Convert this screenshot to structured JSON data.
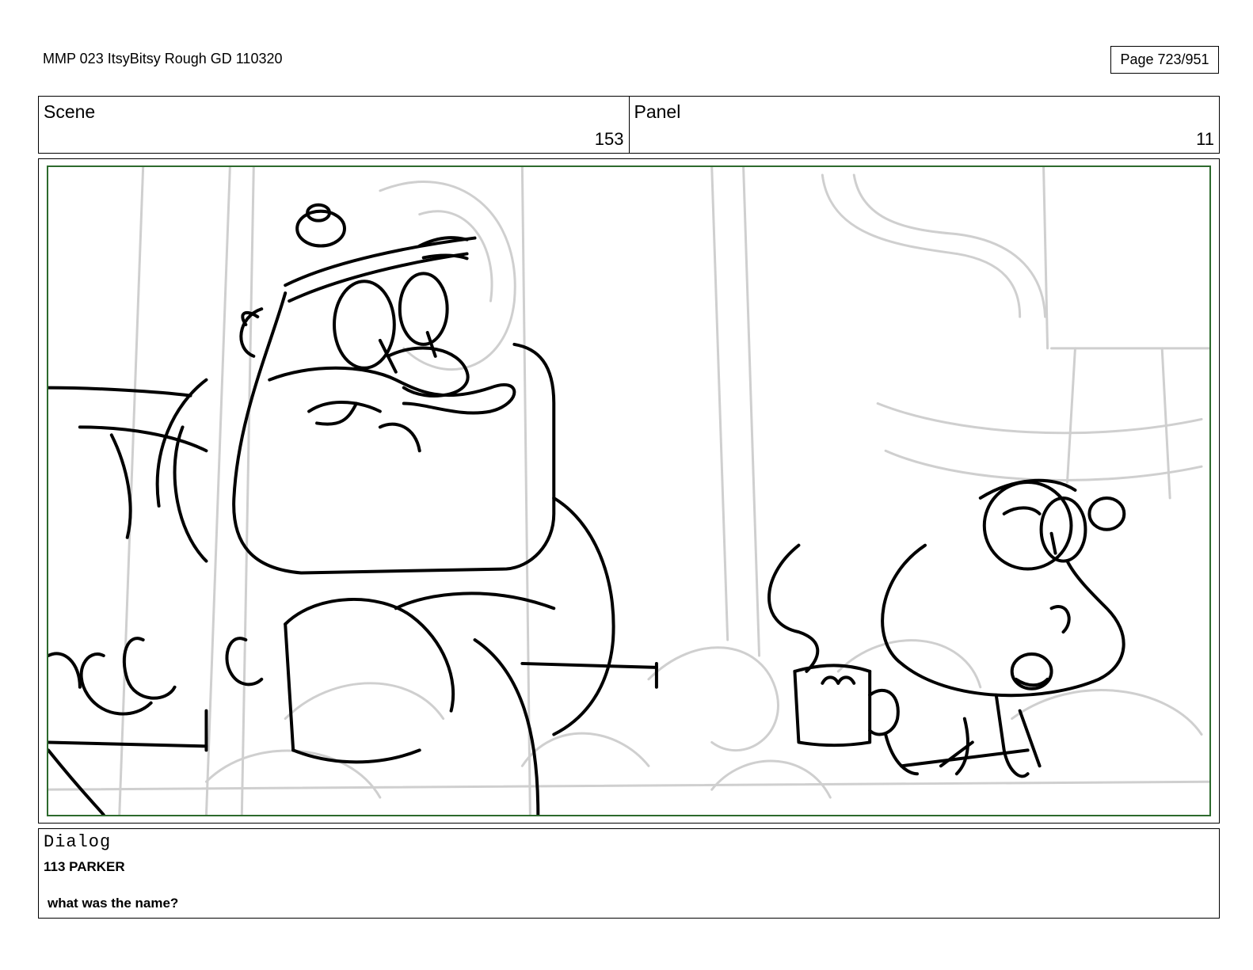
{
  "header": {
    "title": "MMP 023 ItsyBitsy Rough GD 110320",
    "page": "Page 723/951"
  },
  "scene": {
    "label": "Scene",
    "value": "153"
  },
  "panel": {
    "label": "Panel",
    "value": "11"
  },
  "frame": {
    "border_color": "#2d6a2d"
  },
  "dialog": {
    "label": "Dialog",
    "speaker": "113 PARKER",
    "line": "what was the name?"
  }
}
